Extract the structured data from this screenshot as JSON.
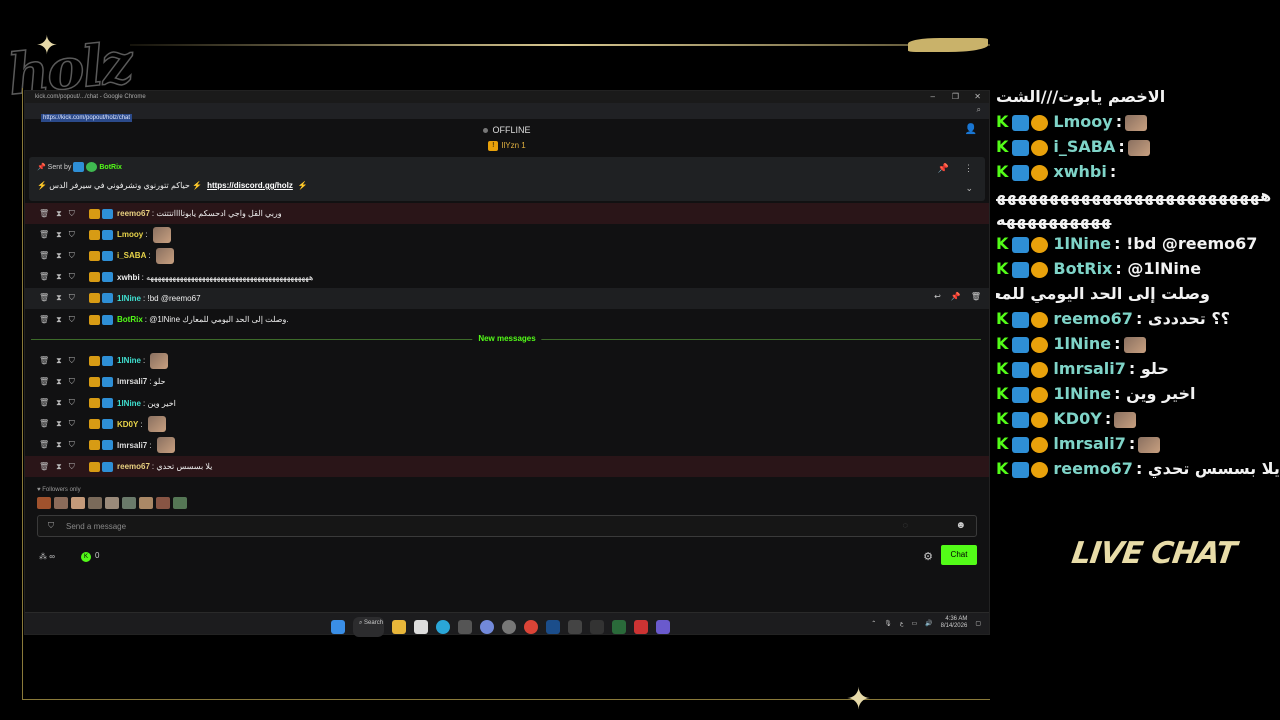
{
  "overlay": {
    "logo_text": "holz",
    "live_chat_label": "LIVE CHAT"
  },
  "browser": {
    "window_title": "kick.com/popout/.../chat - Google Chrome",
    "url": "https://kick.com/popout/holz/chat",
    "minimize": "–",
    "maximize": "❐",
    "close": "✕"
  },
  "chat": {
    "status": "OFFLINE",
    "top_viewer": "IlYzn",
    "top_viewer_count": "1",
    "pinned": {
      "sent_by_label": "Sent by",
      "sender": "BotRix",
      "text_before": "حياكم تتورنوي وتشرفوني في سيرفر الدس",
      "link": "https://discord.gg/holz"
    },
    "messages": [
      {
        "user": "reemo67",
        "color": "#e8d080",
        "text": "وربي القل واجي ادحسكم يابوتااااتتتتت",
        "highlight": true
      },
      {
        "user": "Lmooy",
        "color": "#e8d44a",
        "text": "",
        "emote": true
      },
      {
        "user": "i_SABA",
        "color": "#e8d44a",
        "text": "",
        "emote": true
      },
      {
        "user": "xwhbi",
        "color": "#eeeeee",
        "text": "ههههههههههههههههههههههههههههههههههههههههههههه"
      },
      {
        "user": "1lNine",
        "color": "#3fe0d0",
        "text": "!bd @reemo67",
        "hover": true
      },
      {
        "user": "BotRix",
        "color": "#53fc18",
        "text": "@1lNine وصلت إلى الحد اليومي للمعارك."
      }
    ],
    "new_messages_label": "New messages",
    "new_msgs": [
      {
        "user": "1lNine",
        "color": "#3fe0d0",
        "text": "",
        "emote": true
      },
      {
        "user": "lmrsali7",
        "color": "#dddddd",
        "text": "حلو"
      },
      {
        "user": "1lNine",
        "color": "#3fe0d0",
        "text": "اخير وين"
      },
      {
        "user": "KD0Y",
        "color": "#e8d44a",
        "text": "",
        "emote": true
      },
      {
        "user": "lmrsali7",
        "color": "#dddddd",
        "text": "",
        "emote": true
      },
      {
        "user": "reemo67",
        "color": "#e8d080",
        "text": "يلا بسسس تحدي",
        "highlight": true
      }
    ],
    "followers_only": "Followers only",
    "input_placeholder": "Send a message",
    "infinity_label": "∞",
    "kick_coins": "0",
    "chat_button": "Chat"
  },
  "taskbar": {
    "search_label": "Search",
    "time": "4:36 AM",
    "date": "8/14/2026",
    "lang": "ع"
  },
  "overlay_chat": [
    {
      "name": "",
      "text": "الاخصم يابوت///الشت",
      "partial": true
    },
    {
      "name": "Lmooy",
      "text": ":",
      "emote": true
    },
    {
      "name": "i_SABA",
      "text": ":",
      "emote": true
    },
    {
      "name": "xwhbi",
      "text": ":"
    },
    {
      "name": "",
      "text": "ههههههههههههههههههههههههههههههههههههه",
      "wrap": true
    },
    {
      "name": "1lNine",
      "text": ": !bd @reemo67",
      "wrap": true
    },
    {
      "name": "BotRix",
      "text": ": @1lNine",
      "extra": "وصلت إلى الحد اليومي للمعارك."
    },
    {
      "name": "reemo67",
      "text": ": ؟؟ تحدددى"
    },
    {
      "name": "1lNine",
      "text": ":",
      "emote": true
    },
    {
      "name": "lmrsali7",
      "text": ": حلو"
    },
    {
      "name": "1lNine",
      "text": ": اخير وين"
    },
    {
      "name": "KD0Y",
      "text": ":",
      "emote": true
    },
    {
      "name": "lmrsali7",
      "text": ":",
      "emote": true
    },
    {
      "name": "reemo67",
      "text": ": يلا بسسس تحدي"
    }
  ]
}
